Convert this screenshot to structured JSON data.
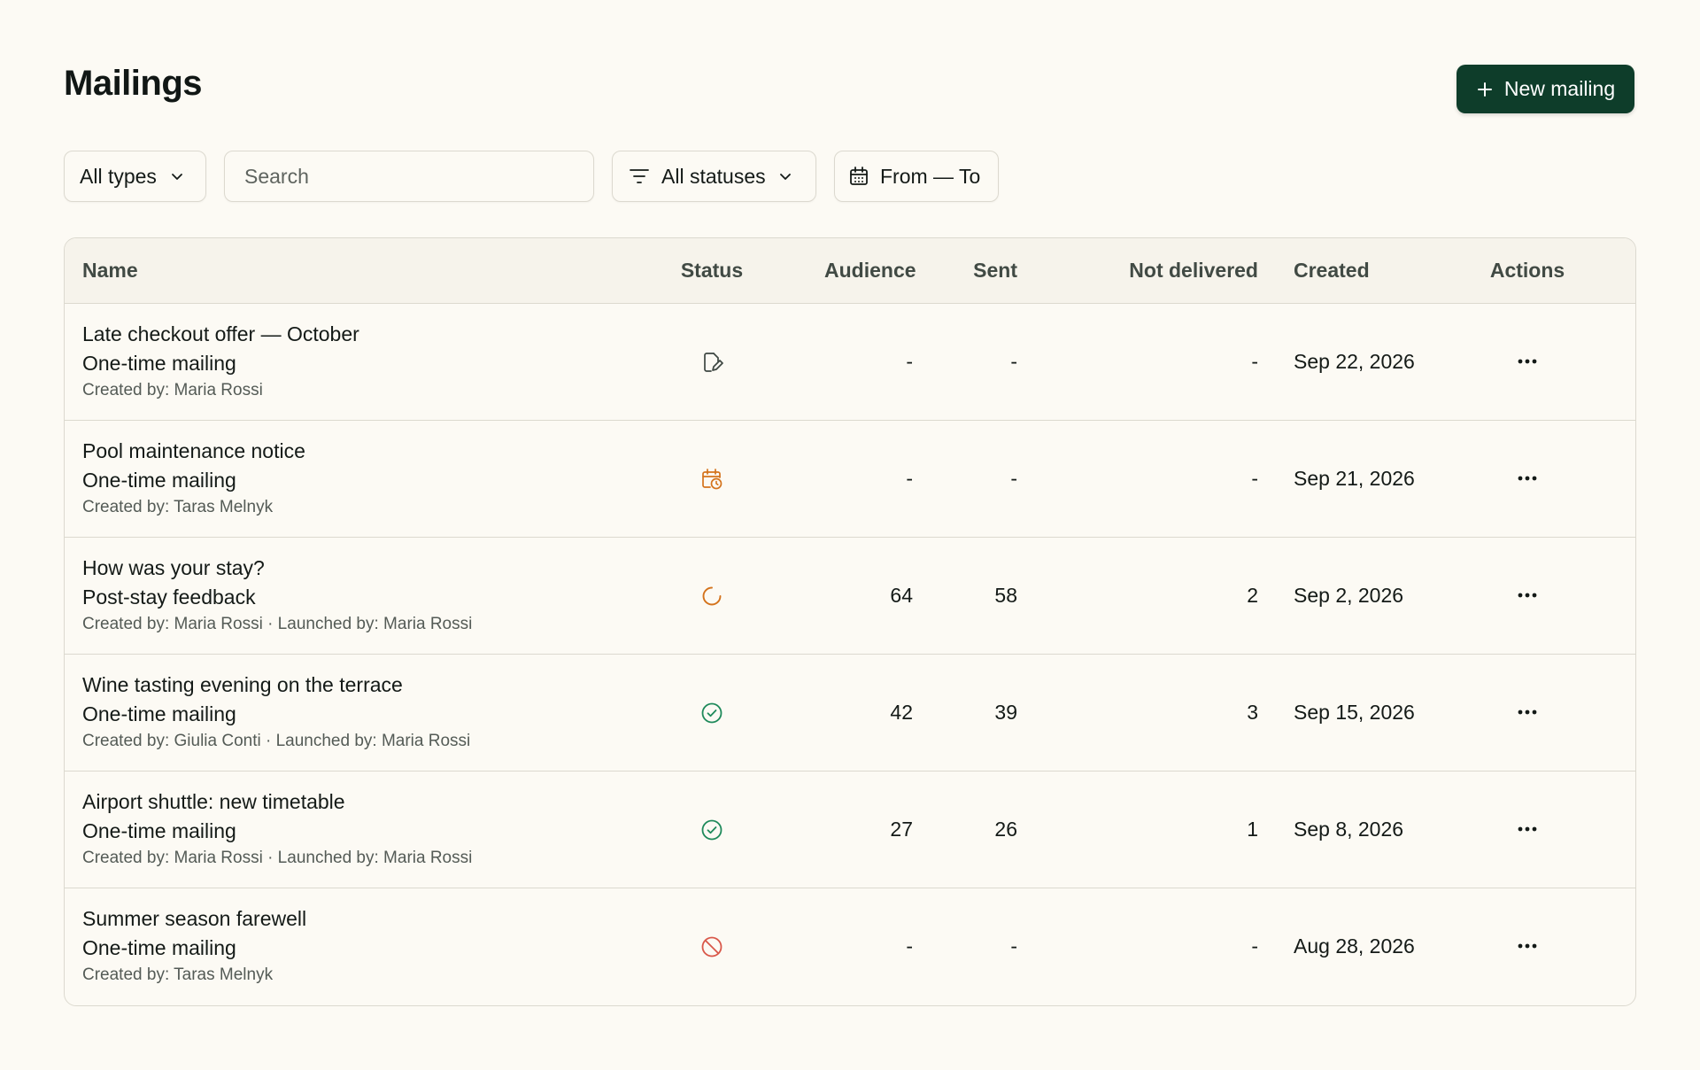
{
  "header": {
    "title": "Mailings",
    "new_button_label": "New mailing"
  },
  "filters": {
    "type_label": "All types",
    "search_placeholder": "Search",
    "search_value": "",
    "status_label": "All statuses",
    "date_label": "From — To"
  },
  "table": {
    "columns": {
      "name": "Name",
      "status": "Status",
      "audience": "Audience",
      "sent": "Sent",
      "not_delivered": "Not delivered",
      "created": "Created",
      "actions": "Actions"
    },
    "rows": [
      {
        "title": "Late checkout offer — October",
        "type": "One-time mailing",
        "meta": "Created by: Maria Rossi",
        "status_icon": "draft-icon",
        "audience": "-",
        "sent": "-",
        "not_delivered": "-",
        "created": "Sep 22, 2026"
      },
      {
        "title": "Pool maintenance notice",
        "type": "One-time mailing",
        "meta": "Created by: Taras Melnyk",
        "status_icon": "scheduled-icon",
        "audience": "-",
        "sent": "-",
        "not_delivered": "-",
        "created": "Sep 21, 2026"
      },
      {
        "title": "How was your stay?",
        "type": "Post-stay feedback",
        "meta": "Created by: Maria Rossi · Launched by: Maria Rossi",
        "status_icon": "in-progress-icon",
        "audience": "64",
        "sent": "58",
        "not_delivered": "2",
        "created": "Sep 2, 2026"
      },
      {
        "title": "Wine tasting evening on the terrace",
        "type": "One-time mailing",
        "meta": "Created by: Giulia Conti · Launched by: Maria Rossi",
        "status_icon": "completed-icon",
        "audience": "42",
        "sent": "39",
        "not_delivered": "3",
        "created": "Sep 15, 2026"
      },
      {
        "title": "Airport shuttle: new timetable",
        "type": "One-time mailing",
        "meta": "Created by: Maria Rossi · Launched by: Maria Rossi",
        "status_icon": "completed-icon",
        "audience": "27",
        "sent": "26",
        "not_delivered": "1",
        "created": "Sep 8, 2026"
      },
      {
        "title": "Summer season farewell",
        "type": "One-time mailing",
        "meta": "Created by: Taras Melnyk",
        "status_icon": "cancelled-icon",
        "audience": "-",
        "sent": "-",
        "not_delivered": "-",
        "created": "Aug 28, 2026"
      }
    ]
  },
  "colors": {
    "primary": "#0e3d2a",
    "background": "#fcfaf4",
    "draft": "#3d4641",
    "scheduled": "#d4731c",
    "in_progress": "#d4731c",
    "completed": "#1f8a5b",
    "cancelled": "#d9584a"
  }
}
